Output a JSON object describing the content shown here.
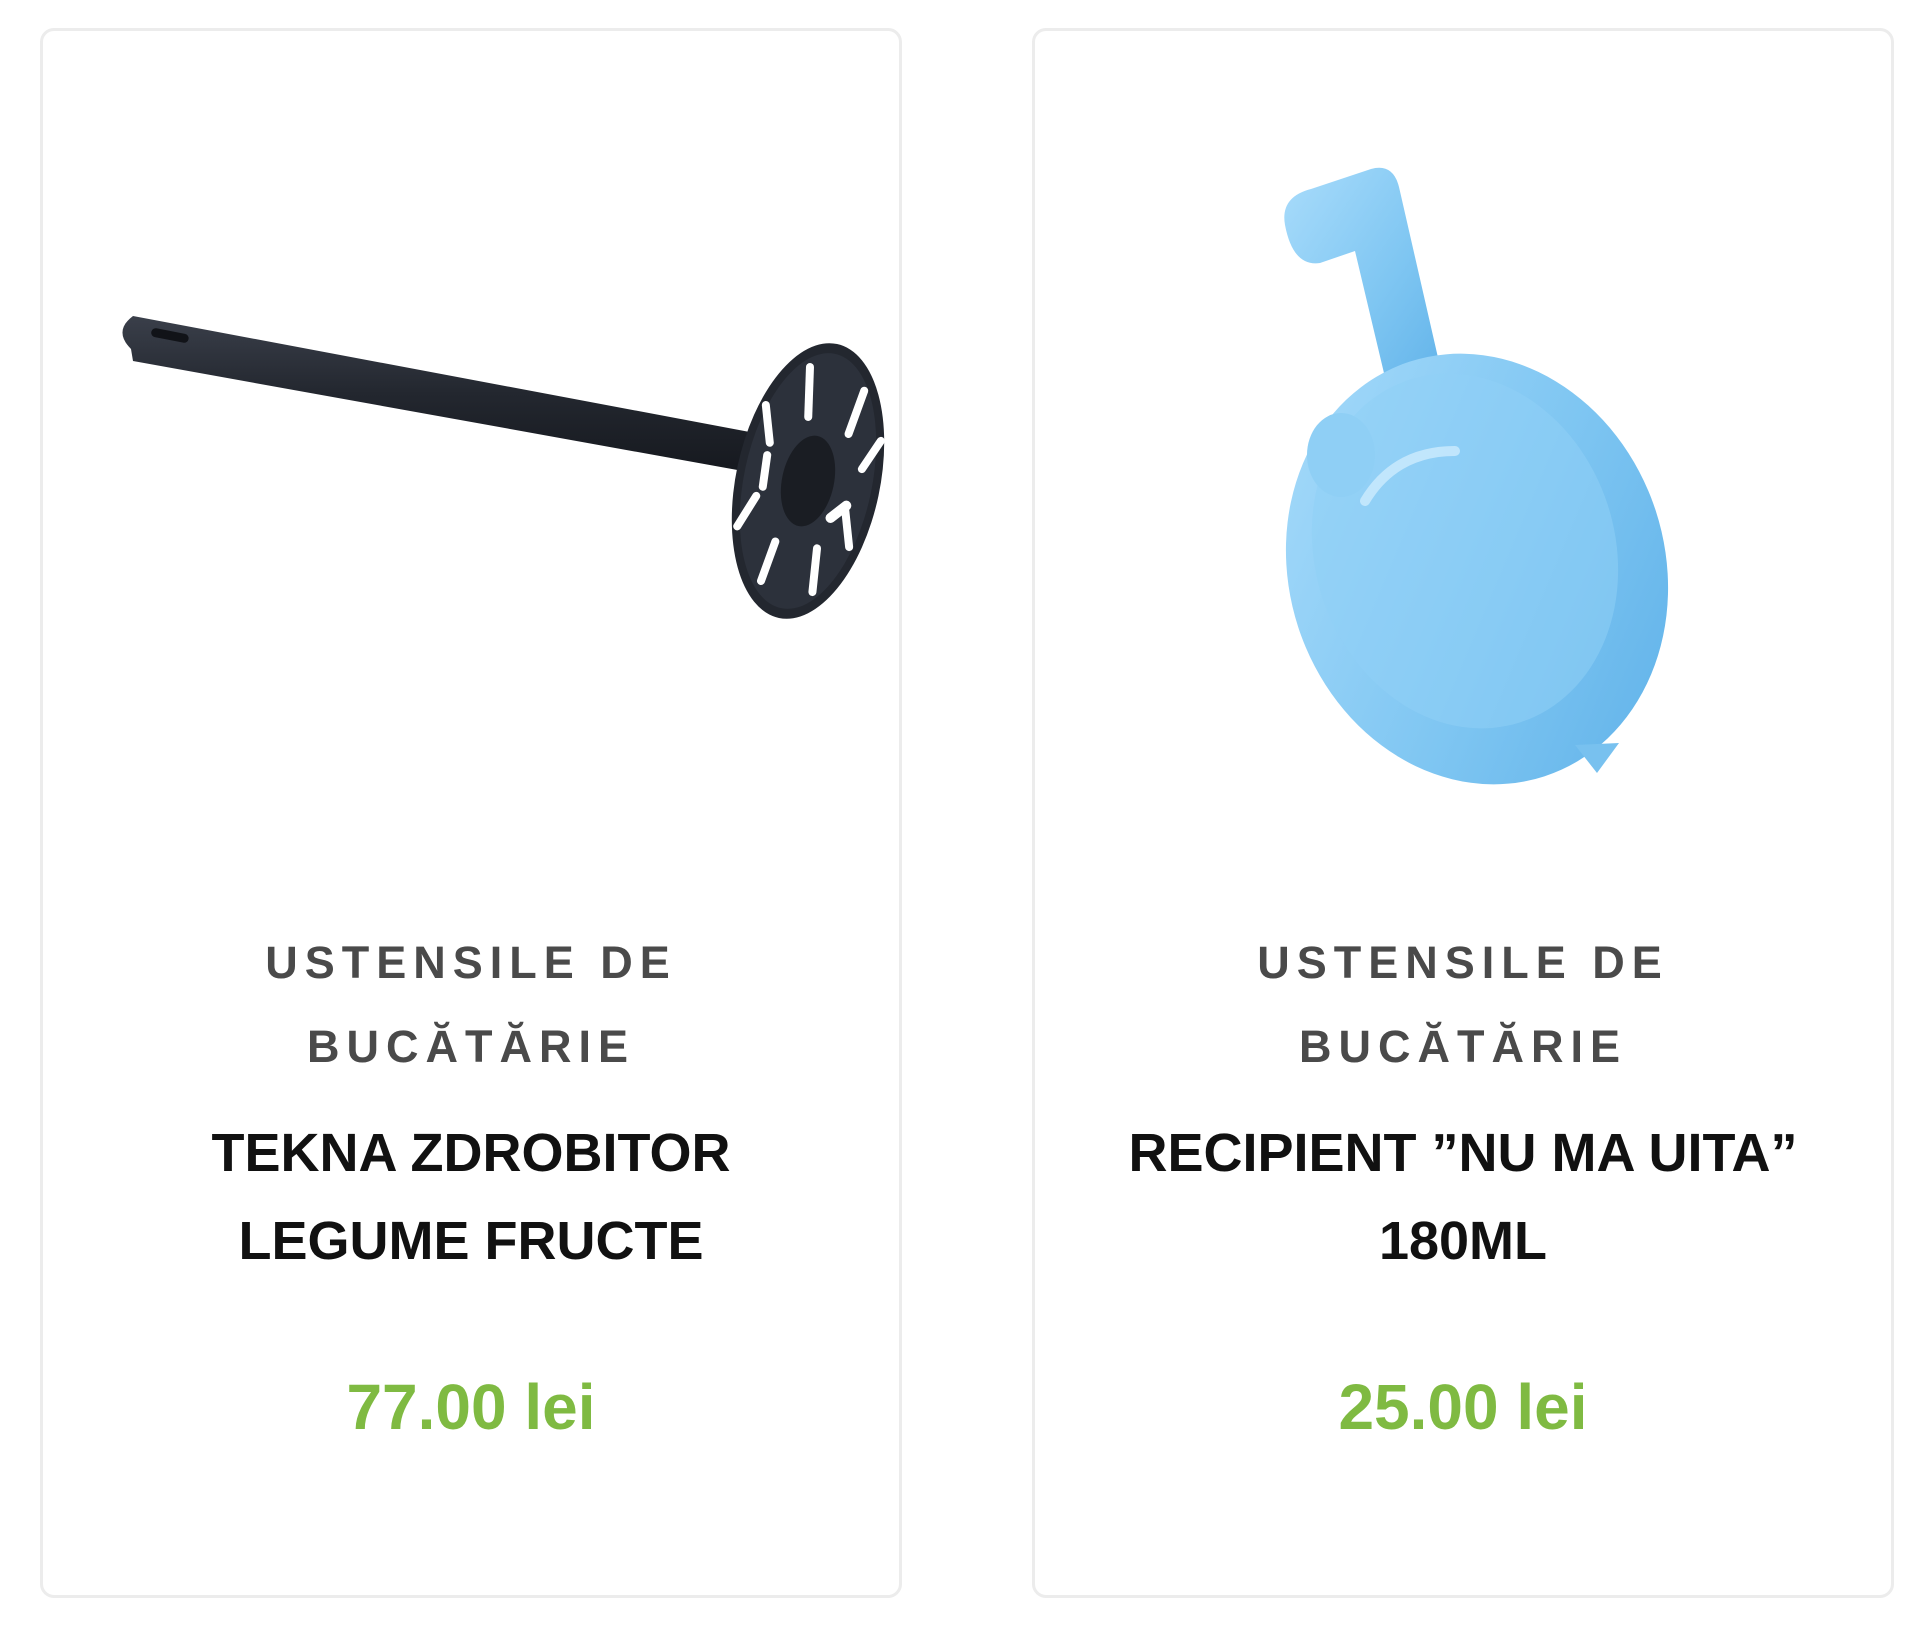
{
  "products": [
    {
      "category": "USTENSILE DE BUCĂTĂRIE",
      "title": "TEKNA ZDROBITOR LEGUME FRUCTE",
      "price": "77.00 lei",
      "image_icon": "potato-masher-image"
    },
    {
      "category": "USTENSILE DE BUCĂTĂRIE",
      "title": "RECIPIENT ”NU MA UITA” 180ML",
      "price": "25.00 lei",
      "image_icon": "blue-container-image"
    }
  ],
  "colors": {
    "price": "#7fba42",
    "category": "#4a4a4a",
    "title": "#111111",
    "card_border": "#ececec"
  }
}
